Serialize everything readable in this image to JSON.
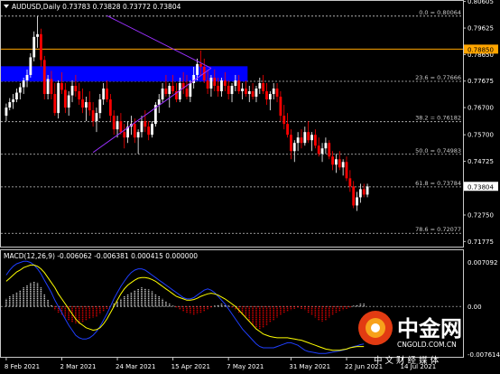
{
  "header": {
    "symbol_line": "AUDUSD,Daily  0.73783 0.73828 0.73772 0.73804",
    "macd_line": "MACD(12,26,9) -0.006062 -0.006381 0.000415 0.000000"
  },
  "colors": {
    "background": "#000000",
    "bull_candle": "#ffffff",
    "bear_candle": "#ff0000",
    "fib_line": "#c8c8c8",
    "resistance_line": "#ffa500",
    "zone": "#0000ff",
    "trendline": "#9b30ff",
    "macd_hist_pos": "#ffffff",
    "macd_hist_neg": "#ff0000",
    "macd_signal": "#ffff00",
    "macd_main": "#1f3fff",
    "price_badge": "#ffffff",
    "resistance_badge": "#ffa500"
  },
  "watermark": {
    "brand": "中金网",
    "url": "CNGOLD.COM.CN",
    "tagline": "中 文 财 经 媒 体"
  },
  "chart_data": {
    "type": "candlestick",
    "price_axis": {
      "range": [
        0.7162,
        0.8059
      ],
      "ticks": [
        0.80605,
        0.79625,
        0.7865,
        0.77675,
        0.767,
        0.757,
        0.74725,
        0.7375,
        0.7275,
        0.71775
      ],
      "tick_labels": [
        "0.80605",
        "0.79625",
        "0.78650",
        "0.77675",
        "0.76700",
        "0.75700",
        "0.74725",
        "0.73750",
        "0.72750",
        "0.71775"
      ]
    },
    "x_axis": {
      "labels": [
        "8 Feb 2021",
        "2 Mar 2021",
        "24 Mar 2021",
        "15 Apr 2021",
        "7 May 2021",
        "31 May 2021",
        "22 Jun 2021",
        "14 Jul 2021"
      ],
      "label_bar_index": [
        0,
        16,
        32,
        48,
        64,
        82,
        98,
        114
      ]
    },
    "fibonacci": [
      {
        "label": "0.0 = 0.80064",
        "value": 0.80064
      },
      {
        "label": "23.6 = 0.77666",
        "value": 0.77666
      },
      {
        "label": "38.2 = 0.76182",
        "value": 0.76182
      },
      {
        "label": "50.0 = 0.74983",
        "value": 0.74983
      },
      {
        "label": "61.8 = 0.73784",
        "value": 0.73784
      },
      {
        "label": "78.6 = 0.72077",
        "value": 0.72077
      }
    ],
    "resistance": {
      "value": 0.7885,
      "label": "0.78850"
    },
    "current_price": {
      "value": 0.73804,
      "label": "0.73804"
    },
    "zone": {
      "low": 0.7766,
      "high": 0.7822
    },
    "triangle": {
      "upper_start": {
        "bar": 29,
        "price": 0.8008
      },
      "apex": {
        "bar": 59,
        "price": 0.7815
      },
      "lower_start": {
        "bar": 25,
        "price": 0.7505
      }
    },
    "candles": [
      [
        0.764,
        0.7685,
        0.762,
        0.767
      ],
      [
        0.767,
        0.7705,
        0.766,
        0.769
      ],
      [
        0.769,
        0.772,
        0.7665,
        0.77
      ],
      [
        0.77,
        0.774,
        0.769,
        0.7725
      ],
      [
        0.7725,
        0.776,
        0.77,
        0.7745
      ],
      [
        0.7745,
        0.778,
        0.772,
        0.777
      ],
      [
        0.777,
        0.781,
        0.7745,
        0.779
      ],
      [
        0.779,
        0.787,
        0.778,
        0.7855
      ],
      [
        0.7855,
        0.795,
        0.784,
        0.793
      ],
      [
        0.793,
        0.8007,
        0.789,
        0.794
      ],
      [
        0.794,
        0.796,
        0.782,
        0.7845
      ],
      [
        0.7845,
        0.786,
        0.77,
        0.772
      ],
      [
        0.772,
        0.779,
        0.77,
        0.7775
      ],
      [
        0.7775,
        0.7805,
        0.77,
        0.772
      ],
      [
        0.772,
        0.776,
        0.764,
        0.765
      ],
      [
        0.765,
        0.777,
        0.763,
        0.776
      ],
      [
        0.776,
        0.78,
        0.772,
        0.7735
      ],
      [
        0.7735,
        0.776,
        0.765,
        0.767
      ],
      [
        0.767,
        0.773,
        0.764,
        0.7715
      ],
      [
        0.7715,
        0.777,
        0.769,
        0.775
      ],
      [
        0.775,
        0.779,
        0.771,
        0.773
      ],
      [
        0.773,
        0.776,
        0.768,
        0.77
      ],
      [
        0.77,
        0.774,
        0.765,
        0.767
      ],
      [
        0.767,
        0.771,
        0.762,
        0.769
      ],
      [
        0.769,
        0.773,
        0.764,
        0.766
      ],
      [
        0.766,
        0.769,
        0.76,
        0.762
      ],
      [
        0.762,
        0.767,
        0.758,
        0.765
      ],
      [
        0.765,
        0.772,
        0.763,
        0.77
      ],
      [
        0.77,
        0.776,
        0.768,
        0.774
      ],
      [
        0.774,
        0.777,
        0.769,
        0.77
      ],
      [
        0.77,
        0.772,
        0.762,
        0.764
      ],
      [
        0.764,
        0.766,
        0.757,
        0.759
      ],
      [
        0.759,
        0.764,
        0.756,
        0.762
      ],
      [
        0.762,
        0.765,
        0.757,
        0.758
      ],
      [
        0.758,
        0.761,
        0.752,
        0.756
      ],
      [
        0.756,
        0.762,
        0.754,
        0.76
      ],
      [
        0.76,
        0.764,
        0.757,
        0.761
      ],
      [
        0.761,
        0.763,
        0.754,
        0.756
      ],
      [
        0.756,
        0.759,
        0.75,
        0.758
      ],
      [
        0.758,
        0.764,
        0.756,
        0.762
      ],
      [
        0.762,
        0.766,
        0.758,
        0.76
      ],
      [
        0.76,
        0.762,
        0.755,
        0.757
      ],
      [
        0.757,
        0.762,
        0.756,
        0.761
      ],
      [
        0.761,
        0.769,
        0.76,
        0.768
      ],
      [
        0.768,
        0.772,
        0.765,
        0.77
      ],
      [
        0.77,
        0.776,
        0.769,
        0.774
      ],
      [
        0.774,
        0.779,
        0.771,
        0.772
      ],
      [
        0.772,
        0.776,
        0.767,
        0.775
      ],
      [
        0.775,
        0.779,
        0.772,
        0.773
      ],
      [
        0.773,
        0.776,
        0.769,
        0.77
      ],
      [
        0.77,
        0.778,
        0.769,
        0.776
      ],
      [
        0.776,
        0.78,
        0.772,
        0.774
      ],
      [
        0.774,
        0.779,
        0.77,
        0.771
      ],
      [
        0.771,
        0.777,
        0.769,
        0.776
      ],
      [
        0.776,
        0.782,
        0.774,
        0.779
      ],
      [
        0.779,
        0.785,
        0.777,
        0.783
      ],
      [
        0.783,
        0.788,
        0.779,
        0.782
      ],
      [
        0.782,
        0.785,
        0.776,
        0.777
      ],
      [
        0.777,
        0.781,
        0.772,
        0.774
      ],
      [
        0.774,
        0.779,
        0.771,
        0.778
      ],
      [
        0.778,
        0.781,
        0.773,
        0.775
      ],
      [
        0.775,
        0.778,
        0.771,
        0.773
      ],
      [
        0.773,
        0.778,
        0.771,
        0.777
      ],
      [
        0.777,
        0.78,
        0.773,
        0.775
      ],
      [
        0.775,
        0.777,
        0.77,
        0.772
      ],
      [
        0.772,
        0.776,
        0.769,
        0.775
      ],
      [
        0.775,
        0.779,
        0.773,
        0.777
      ],
      [
        0.777,
        0.779,
        0.772,
        0.773
      ],
      [
        0.773,
        0.776,
        0.77,
        0.774
      ],
      [
        0.774,
        0.777,
        0.771,
        0.772
      ],
      [
        0.772,
        0.775,
        0.769,
        0.773
      ],
      [
        0.773,
        0.776,
        0.77,
        0.771
      ],
      [
        0.771,
        0.775,
        0.769,
        0.774
      ],
      [
        0.774,
        0.778,
        0.772,
        0.776
      ],
      [
        0.776,
        0.779,
        0.772,
        0.773
      ],
      [
        0.773,
        0.776,
        0.768,
        0.77
      ],
      [
        0.77,
        0.773,
        0.766,
        0.772
      ],
      [
        0.772,
        0.776,
        0.77,
        0.774
      ],
      [
        0.774,
        0.776,
        0.769,
        0.771
      ],
      [
        0.771,
        0.773,
        0.762,
        0.764
      ],
      [
        0.764,
        0.768,
        0.759,
        0.761
      ],
      [
        0.761,
        0.765,
        0.756,
        0.757
      ],
      [
        0.757,
        0.759,
        0.748,
        0.751
      ],
      [
        0.751,
        0.755,
        0.747,
        0.754
      ],
      [
        0.754,
        0.758,
        0.751,
        0.756
      ],
      [
        0.756,
        0.759,
        0.752,
        0.754
      ],
      [
        0.754,
        0.76,
        0.753,
        0.758
      ],
      [
        0.758,
        0.762,
        0.754,
        0.755
      ],
      [
        0.755,
        0.758,
        0.751,
        0.757
      ],
      [
        0.757,
        0.759,
        0.752,
        0.753
      ],
      [
        0.753,
        0.756,
        0.749,
        0.75
      ],
      [
        0.75,
        0.754,
        0.747,
        0.752
      ],
      [
        0.752,
        0.756,
        0.75,
        0.754
      ],
      [
        0.754,
        0.755,
        0.748,
        0.749
      ],
      [
        0.749,
        0.751,
        0.744,
        0.746
      ],
      [
        0.746,
        0.75,
        0.743,
        0.748
      ],
      [
        0.748,
        0.751,
        0.744,
        0.745
      ],
      [
        0.745,
        0.748,
        0.742,
        0.747
      ],
      [
        0.747,
        0.749,
        0.74,
        0.741
      ],
      [
        0.741,
        0.744,
        0.736,
        0.738
      ],
      [
        0.738,
        0.74,
        0.73,
        0.731
      ],
      [
        0.731,
        0.736,
        0.729,
        0.734
      ],
      [
        0.734,
        0.739,
        0.732,
        0.737
      ],
      [
        0.737,
        0.739,
        0.734,
        0.735
      ],
      [
        0.735,
        0.739,
        0.734,
        0.738
      ]
    ],
    "macd": {
      "range": [
        -0.007614,
        0.007092
      ],
      "tick_labels": [
        "0.007092",
        "0.00",
        "-0.007614"
      ],
      "histogram": [
        0.0012,
        0.0016,
        0.0019,
        0.0022,
        0.0026,
        0.003,
        0.0034,
        0.0038,
        0.004,
        0.0038,
        0.003,
        0.002,
        0.001,
        0.0002,
        -0.0006,
        -0.001,
        -0.0014,
        -0.0018,
        -0.0022,
        -0.0025,
        -0.0027,
        -0.0028,
        -0.0026,
        -0.0023,
        -0.002,
        -0.0018,
        -0.0016,
        -0.0012,
        -0.0008,
        -0.0004,
        0.0,
        0.0004,
        0.0008,
        0.0012,
        0.0016,
        0.002,
        0.0023,
        0.0026,
        0.0028,
        0.003,
        0.0029,
        0.0027,
        0.0024,
        0.002,
        0.0016,
        0.0012,
        0.0008,
        0.0004,
        0.0001,
        -0.0002,
        -0.0005,
        -0.0008,
        -0.001,
        -0.0012,
        -0.0013,
        -0.0012,
        -0.001,
        -0.0008,
        -0.0005,
        -0.0002,
        0.0001,
        0.0003,
        0.0004,
        0.0003,
        0.0001,
        -0.0002,
        -0.0006,
        -0.001,
        -0.0014,
        -0.0018,
        -0.0024,
        -0.003,
        -0.0034,
        -0.0036,
        -0.0034,
        -0.003,
        -0.0026,
        -0.0022,
        -0.0018,
        -0.0014,
        -0.001,
        -0.0008,
        -0.0006,
        -0.0004,
        -0.0003,
        -0.0004,
        -0.0006,
        -0.001,
        -0.0014,
        -0.0018,
        -0.0022,
        -0.0024,
        -0.0022,
        -0.0018,
        -0.0014,
        -0.001,
        -0.0008,
        -0.0006,
        -0.0004,
        -0.0002,
        0.0001,
        0.0003,
        0.0004,
        0.0004
      ],
      "signal": [
        0.004,
        0.0045,
        0.005,
        0.0055,
        0.0058,
        0.0062,
        0.0064,
        0.0066,
        0.0066,
        0.0064,
        0.006,
        0.0054,
        0.0046,
        0.0038,
        0.003,
        0.002,
        0.0012,
        0.0004,
        -0.0004,
        -0.0012,
        -0.002,
        -0.0026,
        -0.003,
        -0.0034,
        -0.0036,
        -0.0038,
        -0.0037,
        -0.0034,
        -0.0028,
        -0.002,
        -0.001,
        0.0,
        0.001,
        0.002,
        0.0028,
        0.0034,
        0.0038,
        0.0042,
        0.0045,
        0.0046,
        0.0046,
        0.0045,
        0.0043,
        0.004,
        0.0036,
        0.0032,
        0.0028,
        0.0024,
        0.002,
        0.0016,
        0.0014,
        0.0012,
        0.001,
        0.001,
        0.0011,
        0.0013,
        0.0016,
        0.0018,
        0.002,
        0.0021,
        0.002,
        0.0018,
        0.0015,
        0.0012,
        0.0008,
        0.0004,
        0.0,
        -0.0006,
        -0.0012,
        -0.0018,
        -0.0024,
        -0.003,
        -0.0036,
        -0.004,
        -0.0044,
        -0.0046,
        -0.0048,
        -0.0049,
        -0.005,
        -0.005,
        -0.005,
        -0.005,
        -0.0051,
        -0.0052,
        -0.0053,
        -0.0054,
        -0.0056,
        -0.0058,
        -0.006,
        -0.0062,
        -0.0064,
        -0.0066,
        -0.0068,
        -0.0069,
        -0.007,
        -0.007,
        -0.007,
        -0.0069,
        -0.0068,
        -0.0066,
        -0.0065,
        -0.0064,
        -0.0064,
        -0.0064
      ],
      "main": [
        0.005,
        0.0058,
        0.0064,
        0.0068,
        0.007,
        0.0072,
        0.0072,
        0.007,
        0.0066,
        0.006,
        0.0052,
        0.0042,
        0.0032,
        0.0022,
        0.001,
        0.0,
        -0.001,
        -0.002,
        -0.003,
        -0.0038,
        -0.0046,
        -0.005,
        -0.0052,
        -0.0052,
        -0.005,
        -0.0046,
        -0.004,
        -0.0032,
        -0.0022,
        -0.0012,
        0.0,
        0.0012,
        0.0022,
        0.0032,
        0.004,
        0.0048,
        0.0054,
        0.0058,
        0.006,
        0.006,
        0.0058,
        0.0054,
        0.005,
        0.0046,
        0.0042,
        0.0038,
        0.0034,
        0.003,
        0.0026,
        0.0022,
        0.0018,
        0.0014,
        0.0012,
        0.0012,
        0.0014,
        0.0018,
        0.0022,
        0.0026,
        0.0028,
        0.0026,
        0.0022,
        0.0016,
        0.001,
        0.0004,
        -0.0004,
        -0.0012,
        -0.002,
        -0.0028,
        -0.0036,
        -0.0042,
        -0.0048,
        -0.0054,
        -0.006,
        -0.0064,
        -0.0066,
        -0.0066,
        -0.0066,
        -0.0066,
        -0.0064,
        -0.0062,
        -0.006,
        -0.0058,
        -0.0058,
        -0.006,
        -0.0062,
        -0.0066,
        -0.007,
        -0.0072,
        -0.0073,
        -0.0074,
        -0.0075,
        -0.0075,
        -0.0075,
        -0.0074,
        -0.0073,
        -0.0072,
        -0.0071,
        -0.007,
        -0.0068,
        -0.0066,
        -0.0064,
        -0.0063,
        -0.0061,
        -0.006
      ]
    }
  }
}
